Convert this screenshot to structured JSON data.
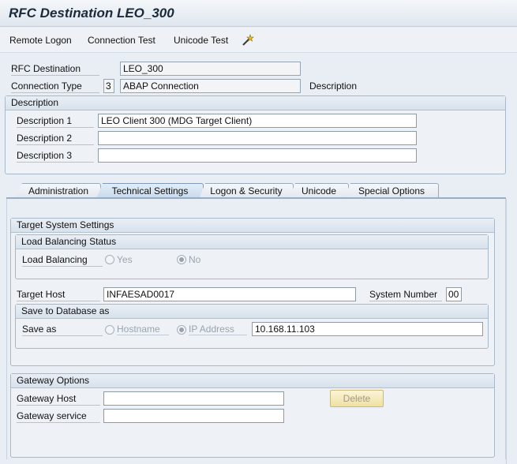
{
  "window": {
    "title": "RFC Destination LEO_300"
  },
  "toolbar": {
    "remote_logon": "Remote Logon",
    "connection_test": "Connection Test",
    "unicode_test": "Unicode Test",
    "icon": "wand-icon"
  },
  "header": {
    "rfc_destination_label": "RFC Destination",
    "rfc_destination_value": "LEO_300",
    "connection_type_label": "Connection Type",
    "connection_type_code": "3",
    "connection_type_text": "ABAP Connection",
    "description_link": "Description"
  },
  "description": {
    "title": "Description",
    "d1_label": "Description 1",
    "d1_value": "LEO Client 300 (MDG Target Client)",
    "d2_label": "Description 2",
    "d2_value": "",
    "d3_label": "Description 3",
    "d3_value": ""
  },
  "tabs": [
    {
      "label": "Administration"
    },
    {
      "label": "Technical Settings",
      "active": true
    },
    {
      "label": "Logon & Security"
    },
    {
      "label": "Unicode"
    },
    {
      "label": "Special Options"
    }
  ],
  "target": {
    "title": "Target System Settings",
    "lb_title": "Load Balancing Status",
    "lb_label": "Load Balancing",
    "lb_yes": "Yes",
    "lb_no": "No",
    "lb_selected": "No",
    "host_label": "Target Host",
    "host_value": "INFAESAD0017",
    "sysnr_label": "System Number",
    "sysnr_value": "00",
    "save_title": "Save to Database as",
    "save_label": "Save as",
    "save_hostname": "Hostname",
    "save_ip": "IP Address",
    "save_selected": "IP Address",
    "ip_value": "10.168.11.103"
  },
  "gateway": {
    "title": "Gateway Options",
    "host_label": "Gateway Host",
    "host_value": "",
    "service_label": "Gateway service",
    "service_value": "",
    "delete_button": "Delete"
  }
}
